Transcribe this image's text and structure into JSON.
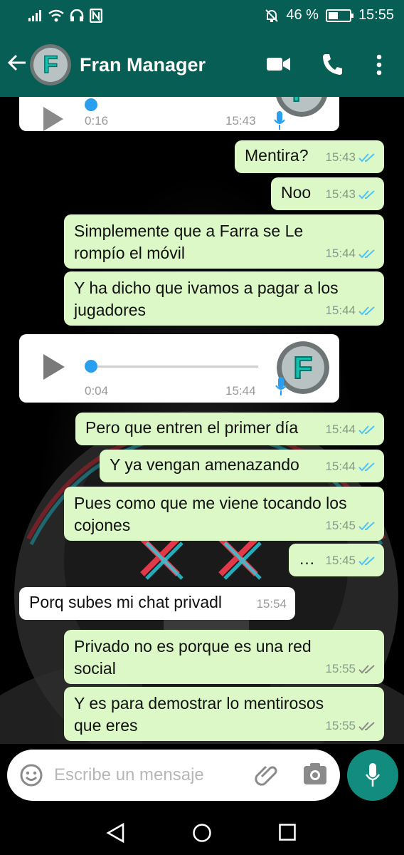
{
  "status_bar": {
    "battery": "46 %",
    "battery_level": 0.46,
    "time": "15:55"
  },
  "header": {
    "contact_name": "Fran Manager",
    "avatar_letter": "F",
    "icons": [
      "back-arrow-icon",
      "video-call-icon",
      "phone-icon",
      "more-icon"
    ]
  },
  "messages": [
    {
      "type": "voice",
      "dir": "in",
      "duration": "0:16",
      "time": "15:43"
    },
    {
      "type": "text",
      "dir": "out",
      "lines": [
        "Mentira?"
      ],
      "time": "15:43",
      "status": "read"
    },
    {
      "type": "text",
      "dir": "out",
      "lines": [
        "Noo"
      ],
      "time": "15:43",
      "status": "read"
    },
    {
      "type": "text",
      "dir": "out",
      "lines": [
        "Simplemente que a Farra se Le",
        "rompío el móvil"
      ],
      "time": "15:44",
      "status": "read"
    },
    {
      "type": "text",
      "dir": "out",
      "lines": [
        "Y ha dicho que ivamos a pagar a los",
        "jugadores"
      ],
      "time": "15:44",
      "status": "read"
    },
    {
      "type": "voice",
      "dir": "in",
      "duration": "0:04",
      "time": "15:44"
    },
    {
      "type": "text",
      "dir": "out",
      "lines": [
        "Pero que entren el primer día"
      ],
      "time": "15:44",
      "status": "read"
    },
    {
      "type": "text",
      "dir": "out",
      "lines": [
        "Y ya vengan amenazando"
      ],
      "time": "15:44",
      "status": "read"
    },
    {
      "type": "text",
      "dir": "out",
      "lines": [
        "Pues como que me viene tocando los",
        "cojones"
      ],
      "time": "15:45",
      "status": "read"
    },
    {
      "type": "text",
      "dir": "out",
      "lines": [
        "…"
      ],
      "time": "15:45",
      "status": "read"
    },
    {
      "type": "text",
      "dir": "in",
      "lines": [
        "Porq subes mi chat privadl"
      ],
      "time": "15:54"
    },
    {
      "type": "text",
      "dir": "out",
      "lines": [
        "Privado no es porque es una red",
        "social"
      ],
      "time": "15:55",
      "status": "delivered"
    },
    {
      "type": "text",
      "dir": "out",
      "lines": [
        "Y es para demostrar lo mentirosos",
        "que eres"
      ],
      "time": "15:55",
      "status": "delivered"
    }
  ],
  "input": {
    "placeholder": "Escribe un mensaje",
    "icons": [
      "emoji-icon",
      "attach-icon",
      "camera-icon",
      "mic-icon"
    ]
  },
  "colors": {
    "header": "#075e54",
    "outgoing_bubble": "#dcf8c6",
    "incoming_bubble": "#ffffff",
    "read_tick": "#4fc3f7",
    "delivered_tick": "#8a8a8a",
    "mic_button": "#128c7e"
  }
}
